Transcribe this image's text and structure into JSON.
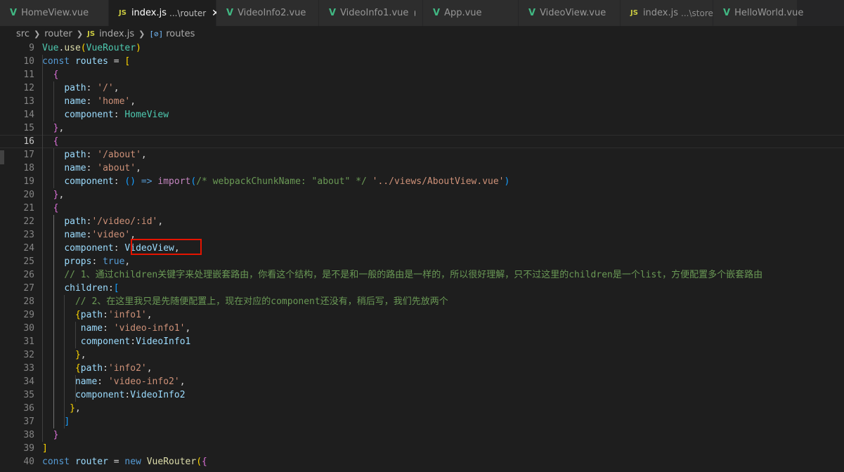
{
  "tabs": [
    {
      "icon": "V",
      "label": "HomeView.vue",
      "active": false
    },
    {
      "icon": "JS",
      "label": "index.js",
      "desc": "...\\router",
      "active": true,
      "close": "✕"
    },
    {
      "icon": "V",
      "label": "VideoInfo2.vue",
      "active": false
    },
    {
      "icon": "V",
      "label": "VideoInfo1.vue",
      "active": false,
      "modified": true
    },
    {
      "icon": "V",
      "label": "App.vue",
      "active": false
    },
    {
      "icon": "V",
      "label": "VideoView.vue",
      "active": false
    },
    {
      "icon": "JS",
      "label": "index.js",
      "desc": "...\\store",
      "active": false
    },
    {
      "icon": "V",
      "label": "HelloWorld.vue",
      "active": false
    }
  ],
  "breadcrumb": {
    "parts": [
      "src",
      "router",
      "index.js",
      "routes"
    ],
    "file_icon": "JS",
    "symbol_icon": "[⊘]"
  },
  "editor": {
    "current_line": 16,
    "lines": [
      {
        "n": "9",
        "tokens": [
          [
            "Vue",
            "t-c"
          ],
          [
            ".",
            "t-p"
          ],
          [
            "use",
            "t-f"
          ],
          [
            "(",
            "t-b1"
          ],
          [
            "VueRouter",
            "t-c"
          ],
          [
            ")",
            "t-b1"
          ]
        ]
      },
      {
        "n": "10",
        "tokens": [
          [
            "const ",
            "t-k"
          ],
          [
            "routes",
            "t-v"
          ],
          [
            " = ",
            "t-p"
          ],
          [
            "[",
            "t-b1"
          ]
        ]
      },
      {
        "n": "11",
        "tokens": [
          [
            "  ",
            "t-p"
          ],
          [
            "{",
            "t-b2"
          ]
        ]
      },
      {
        "n": "12",
        "tokens": [
          [
            "    ",
            "t-p"
          ],
          [
            "path",
            "t-v"
          ],
          [
            ": ",
            "t-p"
          ],
          [
            "'/'",
            "t-s"
          ],
          [
            ",",
            "t-p"
          ]
        ]
      },
      {
        "n": "13",
        "tokens": [
          [
            "    ",
            "t-p"
          ],
          [
            "name",
            "t-v"
          ],
          [
            ": ",
            "t-p"
          ],
          [
            "'home'",
            "t-s"
          ],
          [
            ",",
            "t-p"
          ]
        ]
      },
      {
        "n": "14",
        "tokens": [
          [
            "    ",
            "t-p"
          ],
          [
            "component",
            "t-v"
          ],
          [
            ": ",
            "t-p"
          ],
          [
            "HomeView",
            "t-c"
          ]
        ]
      },
      {
        "n": "15",
        "tokens": [
          [
            "  ",
            "t-p"
          ],
          [
            "}",
            "t-b2"
          ],
          [
            ",",
            "t-p"
          ]
        ]
      },
      {
        "n": "16",
        "tokens": [
          [
            "  ",
            "t-p"
          ],
          [
            "{",
            "t-b2"
          ]
        ]
      },
      {
        "n": "17",
        "tokens": [
          [
            "    ",
            "t-p"
          ],
          [
            "path",
            "t-v"
          ],
          [
            ": ",
            "t-p"
          ],
          [
            "'/about'",
            "t-s"
          ],
          [
            ",",
            "t-p"
          ]
        ]
      },
      {
        "n": "18",
        "tokens": [
          [
            "    ",
            "t-p"
          ],
          [
            "name",
            "t-v"
          ],
          [
            ": ",
            "t-p"
          ],
          [
            "'about'",
            "t-s"
          ],
          [
            ",",
            "t-p"
          ]
        ]
      },
      {
        "n": "19",
        "tokens": [
          [
            "    ",
            "t-p"
          ],
          [
            "component",
            "t-v"
          ],
          [
            ": ",
            "t-p"
          ],
          [
            "()",
            "t-b3"
          ],
          [
            " => ",
            "t-k"
          ],
          [
            "import",
            "t-kw"
          ],
          [
            "(",
            "t-b3"
          ],
          [
            "/* webpackChunkName: \"about\" */",
            "t-cm"
          ],
          [
            " ",
            "t-p"
          ],
          [
            "'../views/AboutView.vue'",
            "t-s"
          ],
          [
            ")",
            "t-b3"
          ]
        ]
      },
      {
        "n": "20",
        "tokens": [
          [
            "  ",
            "t-p"
          ],
          [
            "}",
            "t-b2"
          ],
          [
            ",",
            "t-p"
          ]
        ]
      },
      {
        "n": "21",
        "tokens": [
          [
            "  ",
            "t-p"
          ],
          [
            "{",
            "t-b2"
          ]
        ]
      },
      {
        "n": "22",
        "tokens": [
          [
            "    ",
            "t-p"
          ],
          [
            "path",
            "t-v"
          ],
          [
            ":",
            "t-p"
          ],
          [
            "'/video/:id'",
            "t-s"
          ],
          [
            ",",
            "t-p"
          ]
        ]
      },
      {
        "n": "23",
        "tokens": [
          [
            "    ",
            "t-p"
          ],
          [
            "name",
            "t-v"
          ],
          [
            ":",
            "t-p"
          ],
          [
            "'video'",
            "t-s"
          ],
          [
            ",",
            "t-p"
          ]
        ]
      },
      {
        "n": "24",
        "tokens": [
          [
            "    ",
            "t-p"
          ],
          [
            "component",
            "t-v"
          ],
          [
            ": ",
            "t-p"
          ],
          [
            "VideoView",
            "t-v"
          ],
          [
            ",",
            "t-p"
          ]
        ]
      },
      {
        "n": "25",
        "tokens": [
          [
            "    ",
            "t-p"
          ],
          [
            "props",
            "t-v"
          ],
          [
            ": ",
            "t-p"
          ],
          [
            "true",
            "t-k"
          ],
          [
            ",",
            "t-p"
          ]
        ]
      },
      {
        "n": "26",
        "tokens": [
          [
            "    ",
            "t-p"
          ],
          [
            "// 1、通过children关键字来处理嵌套路由，你看这个结构，是不是和一般的路由是一样的，所以很好理解，只不过这里的children是一个list，方便配置多个嵌套路由",
            "t-cm"
          ]
        ]
      },
      {
        "n": "27",
        "tokens": [
          [
            "    ",
            "t-p"
          ],
          [
            "children",
            "t-v"
          ],
          [
            ":",
            "t-p"
          ],
          [
            "[",
            "t-b3"
          ]
        ]
      },
      {
        "n": "28",
        "tokens": [
          [
            "      ",
            "t-p"
          ],
          [
            "// 2、在这里我只是先随便配置上，现在对应的component还没有，稍后写，我们先放两个",
            "t-cm"
          ]
        ]
      },
      {
        "n": "29",
        "tokens": [
          [
            "      ",
            "t-p"
          ],
          [
            "{",
            "t-b1"
          ],
          [
            "path",
            "t-v"
          ],
          [
            ":",
            "t-p"
          ],
          [
            "'info1'",
            "t-s"
          ],
          [
            ",",
            "t-p"
          ]
        ]
      },
      {
        "n": "30",
        "tokens": [
          [
            "       ",
            "t-p"
          ],
          [
            "name",
            "t-v"
          ],
          [
            ": ",
            "t-p"
          ],
          [
            "'video-info1'",
            "t-s"
          ],
          [
            ",",
            "t-p"
          ]
        ]
      },
      {
        "n": "31",
        "tokens": [
          [
            "       ",
            "t-p"
          ],
          [
            "component",
            "t-v"
          ],
          [
            ":",
            "t-p"
          ],
          [
            "VideoInfo1",
            "t-v"
          ]
        ]
      },
      {
        "n": "32",
        "tokens": [
          [
            "      ",
            "t-p"
          ],
          [
            "}",
            "t-b1"
          ],
          [
            ",",
            "t-p"
          ]
        ]
      },
      {
        "n": "33",
        "tokens": [
          [
            "      ",
            "t-p"
          ],
          [
            "{",
            "t-b1"
          ],
          [
            "path",
            "t-v"
          ],
          [
            ":",
            "t-p"
          ],
          [
            "'info2'",
            "t-s"
          ],
          [
            ",",
            "t-p"
          ]
        ]
      },
      {
        "n": "34",
        "tokens": [
          [
            "      ",
            "t-p"
          ],
          [
            "name",
            "t-v"
          ],
          [
            ": ",
            "t-p"
          ],
          [
            "'video-info2'",
            "t-s"
          ],
          [
            ",",
            "t-p"
          ]
        ]
      },
      {
        "n": "35",
        "tokens": [
          [
            "      ",
            "t-p"
          ],
          [
            "component",
            "t-v"
          ],
          [
            ":",
            "t-p"
          ],
          [
            "VideoInfo2",
            "t-v"
          ]
        ]
      },
      {
        "n": "36",
        "tokens": [
          [
            "     ",
            "t-p"
          ],
          [
            "}",
            "t-b1"
          ],
          [
            ",",
            "t-p"
          ]
        ]
      },
      {
        "n": "37",
        "tokens": [
          [
            "    ",
            "t-p"
          ],
          [
            "]",
            "t-b3"
          ]
        ]
      },
      {
        "n": "38",
        "tokens": [
          [
            "  ",
            "t-p"
          ],
          [
            "}",
            "t-b2"
          ]
        ]
      },
      {
        "n": "39",
        "tokens": [
          [
            "]",
            "t-b1"
          ]
        ]
      },
      {
        "n": "40",
        "tokens": [
          [
            "const ",
            "t-k"
          ],
          [
            "router",
            "t-v"
          ],
          [
            " = ",
            "t-p"
          ],
          [
            "new ",
            "t-k"
          ],
          [
            "VueRouter",
            "t-f"
          ],
          [
            "(",
            "t-b1"
          ],
          [
            "{",
            "t-b2"
          ]
        ]
      }
    ]
  },
  "annotation": {
    "highlighted_text": "VideoView,",
    "line": 24,
    "color": "#e51400"
  },
  "colors": {
    "editor_bg": "#1e1e1e",
    "tab_inactive_bg": "#2d2d2d",
    "vue_icon": "#41b883",
    "js_icon": "#cbcb41"
  }
}
